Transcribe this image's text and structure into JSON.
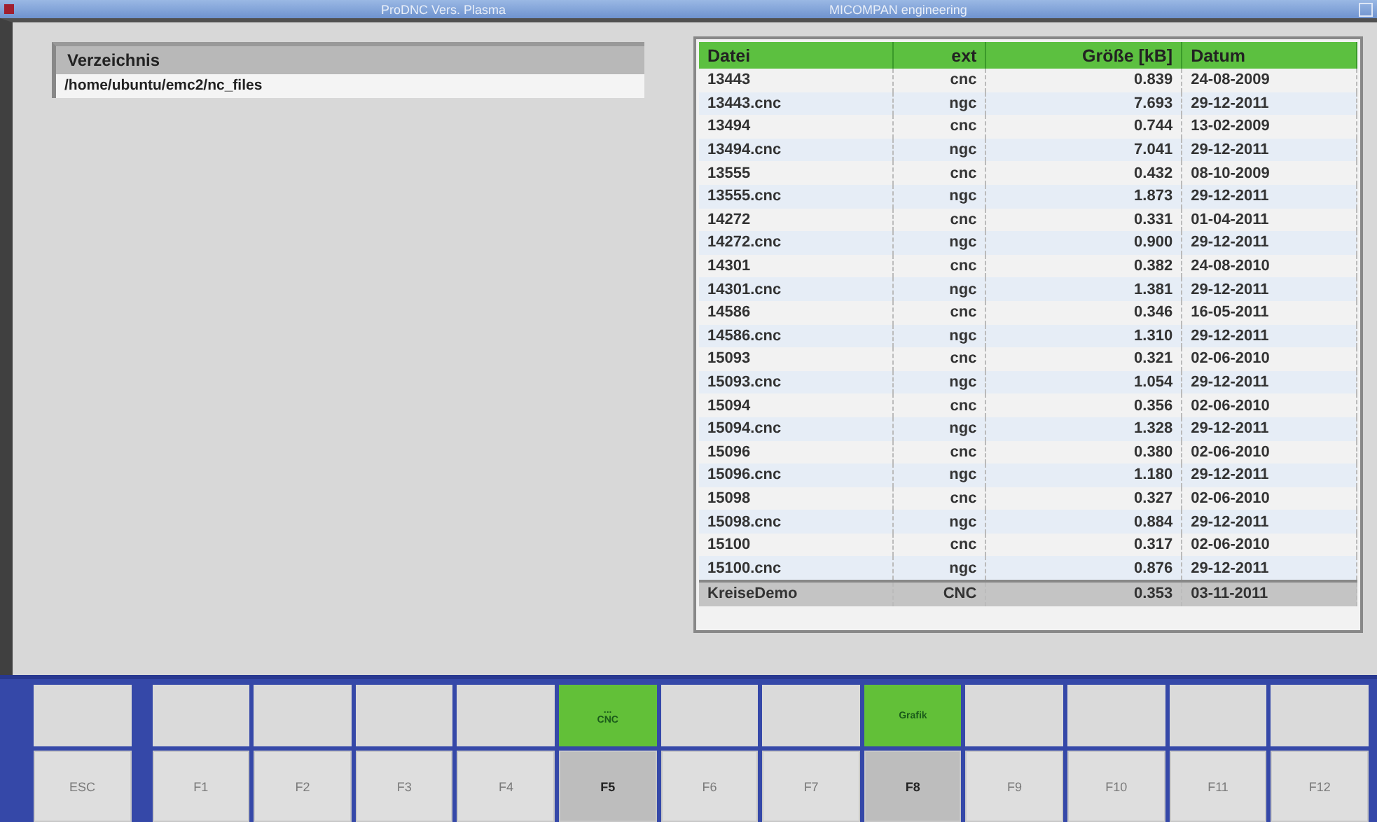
{
  "window": {
    "title_left": "ProDNC Vers. Plasma",
    "title_right": "MICOMPAN engineering"
  },
  "directory": {
    "header": "Verzeichnis",
    "path": "/home/ubuntu/emc2/nc_files"
  },
  "table": {
    "columns": [
      "Datei",
      "ext",
      "Größe [kB]",
      "Datum"
    ],
    "rows": [
      {
        "cells": [
          "13443",
          "cnc",
          "0.839",
          "24-08-2009"
        ],
        "selected": false
      },
      {
        "cells": [
          "13443.cnc",
          "ngc",
          "7.693",
          "29-12-2011"
        ],
        "selected": false
      },
      {
        "cells": [
          "13494",
          "cnc",
          "0.744",
          "13-02-2009"
        ],
        "selected": false
      },
      {
        "cells": [
          "13494.cnc",
          "ngc",
          "7.041",
          "29-12-2011"
        ],
        "selected": false
      },
      {
        "cells": [
          "13555",
          "cnc",
          "0.432",
          "08-10-2009"
        ],
        "selected": false
      },
      {
        "cells": [
          "13555.cnc",
          "ngc",
          "1.873",
          "29-12-2011"
        ],
        "selected": false
      },
      {
        "cells": [
          "14272",
          "cnc",
          "0.331",
          "01-04-2011"
        ],
        "selected": false
      },
      {
        "cells": [
          "14272.cnc",
          "ngc",
          "0.900",
          "29-12-2011"
        ],
        "selected": false
      },
      {
        "cells": [
          "14301",
          "cnc",
          "0.382",
          "24-08-2010"
        ],
        "selected": false
      },
      {
        "cells": [
          "14301.cnc",
          "ngc",
          "1.381",
          "29-12-2011"
        ],
        "selected": false
      },
      {
        "cells": [
          "14586",
          "cnc",
          "0.346",
          "16-05-2011"
        ],
        "selected": false
      },
      {
        "cells": [
          "14586.cnc",
          "ngc",
          "1.310",
          "29-12-2011"
        ],
        "selected": false
      },
      {
        "cells": [
          "15093",
          "cnc",
          "0.321",
          "02-06-2010"
        ],
        "selected": false
      },
      {
        "cells": [
          "15093.cnc",
          "ngc",
          "1.054",
          "29-12-2011"
        ],
        "selected": false
      },
      {
        "cells": [
          "15094",
          "cnc",
          "0.356",
          "02-06-2010"
        ],
        "selected": false
      },
      {
        "cells": [
          "15094.cnc",
          "ngc",
          "1.328",
          "29-12-2011"
        ],
        "selected": false
      },
      {
        "cells": [
          "15096",
          "cnc",
          "0.380",
          "02-06-2010"
        ],
        "selected": false
      },
      {
        "cells": [
          "15096.cnc",
          "ngc",
          "1.180",
          "29-12-2011"
        ],
        "selected": false
      },
      {
        "cells": [
          "15098",
          "cnc",
          "0.327",
          "02-06-2010"
        ],
        "selected": false
      },
      {
        "cells": [
          "15098.cnc",
          "ngc",
          "0.884",
          "29-12-2011"
        ],
        "selected": false
      },
      {
        "cells": [
          "15100",
          "cnc",
          "0.317",
          "02-06-2010"
        ],
        "selected": false
      },
      {
        "cells": [
          "15100.cnc",
          "ngc",
          "0.876",
          "29-12-2011"
        ],
        "selected": false
      },
      {
        "cells": [
          "KreiseDemo",
          "CNC",
          "0.353",
          "03-11-2011"
        ],
        "selected": true
      }
    ]
  },
  "keys": [
    {
      "key": "ESC",
      "active": false
    },
    {
      "key": "F1",
      "active": false
    },
    {
      "key": "F2",
      "active": false
    },
    {
      "key": "F3",
      "active": false
    },
    {
      "key": "F4",
      "active": false
    },
    {
      "soft": [
        "...",
        "CNC"
      ],
      "key": "F5",
      "active": true
    },
    {
      "key": "F6",
      "active": false
    },
    {
      "key": "F7",
      "active": false
    },
    {
      "soft": [
        "Grafik"
      ],
      "key": "F8",
      "active": true
    },
    {
      "key": "F9",
      "active": false
    },
    {
      "key": "F10",
      "active": false
    },
    {
      "key": "F11",
      "active": false
    },
    {
      "key": "F12",
      "active": false
    }
  ]
}
